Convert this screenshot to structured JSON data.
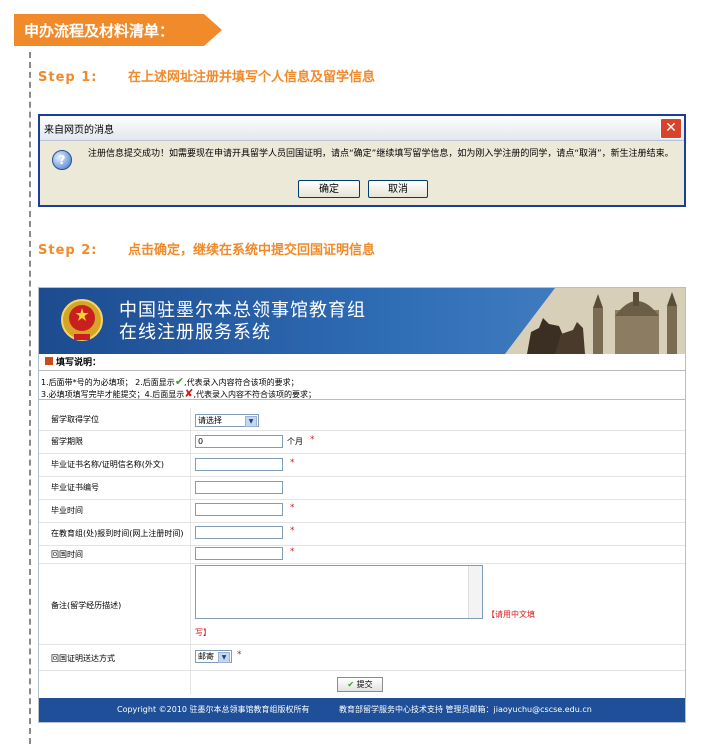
{
  "section_header": "申办流程及材料清单：",
  "steps": [
    {
      "label": "Step 1:",
      "text": "在上述网址注册并填写个人信息及留学信息"
    },
    {
      "label": "Step 2:",
      "text": "点击确定，继续在系统中提交回国证明信息"
    }
  ],
  "dialog": {
    "title": "来自网页的消息",
    "close_glyph": "✕",
    "question_glyph": "?",
    "message": "注册信息提交成功！如需要现在申请开具留学人员回国证明，请点“确定”继续填写留学信息，如为刚入学注册的同学，请点“取消”，新生注册结束。",
    "ok_label": "确定",
    "cancel_label": "取消"
  },
  "website": {
    "banner_title_1": "中国驻墨尔本总领事馆教育组",
    "banner_title_2": "在线注册服务系统",
    "instructions_title": "填写说明：",
    "note_1a": "1.后面带*号的为必填项；  2.后面显示",
    "note_1b": ",代表录入内容符合该项的要求；",
    "note_2a": "3.必填项填写完毕才能提交；4.后面显示",
    "note_2b": ",代表录入内容不符合该项的要求；",
    "check_glyph": "✔",
    "cross_glyph": "✘",
    "form": {
      "degree_label": "留学取得学位",
      "degree_value": "请选择",
      "duration_label": "留学期限",
      "duration_value": "0",
      "duration_unit": "个月",
      "cert_name_label": "毕业证书名称/证明信名称(外文)",
      "cert_no_label": "毕业证书编号",
      "grad_time_label": "毕业时间",
      "report_time_label": "在教育组(处)报到时间(网上注册时间)",
      "return_time_label": "回国时间",
      "remarks_label": "备注(留学经历描述)",
      "remarks_hint_1": "【请用中文填",
      "remarks_hint_2": "写】",
      "delivery_label": "回国证明送达方式",
      "delivery_value": "邮寄",
      "required_mark": "*",
      "submit_label": "提交",
      "submit_glyph": "✔"
    },
    "footer_left": "Copyright ©2010 驻墨尔本总领事馆教育组版权所有",
    "footer_right": "教育部留学服务中心技术支持  管理员邮箱：jiaoyuchu@cscse.edu.cn"
  }
}
